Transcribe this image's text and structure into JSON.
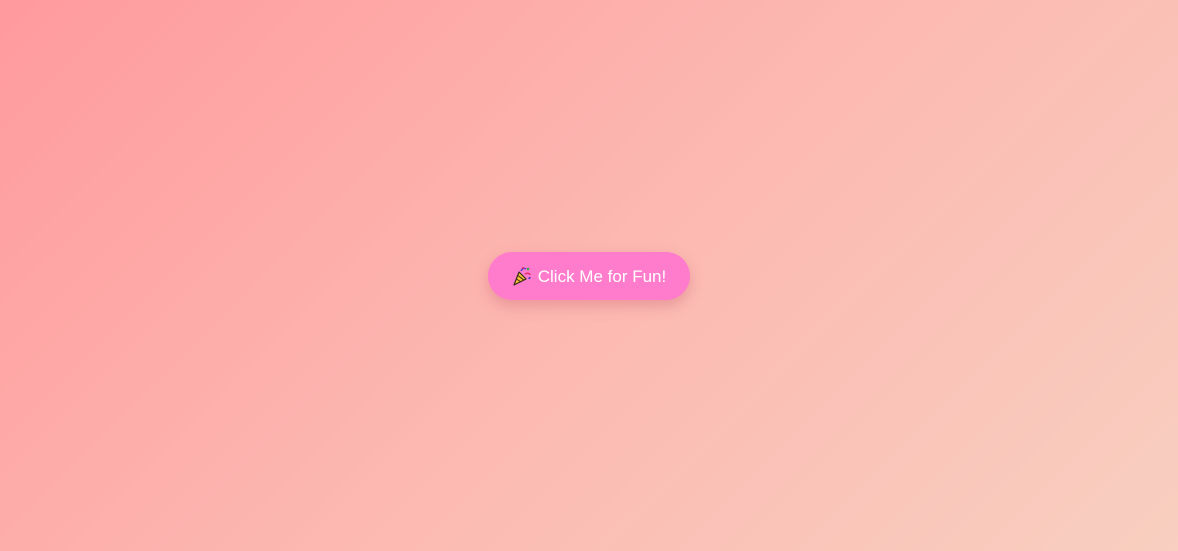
{
  "main": {
    "button": {
      "icon": "party-popper-icon",
      "label": "Click Me for Fun!"
    }
  },
  "colors": {
    "button_bg": "#ff7ccc",
    "background_start": "#ff9a9e",
    "background_end": "#f8cfc0"
  }
}
